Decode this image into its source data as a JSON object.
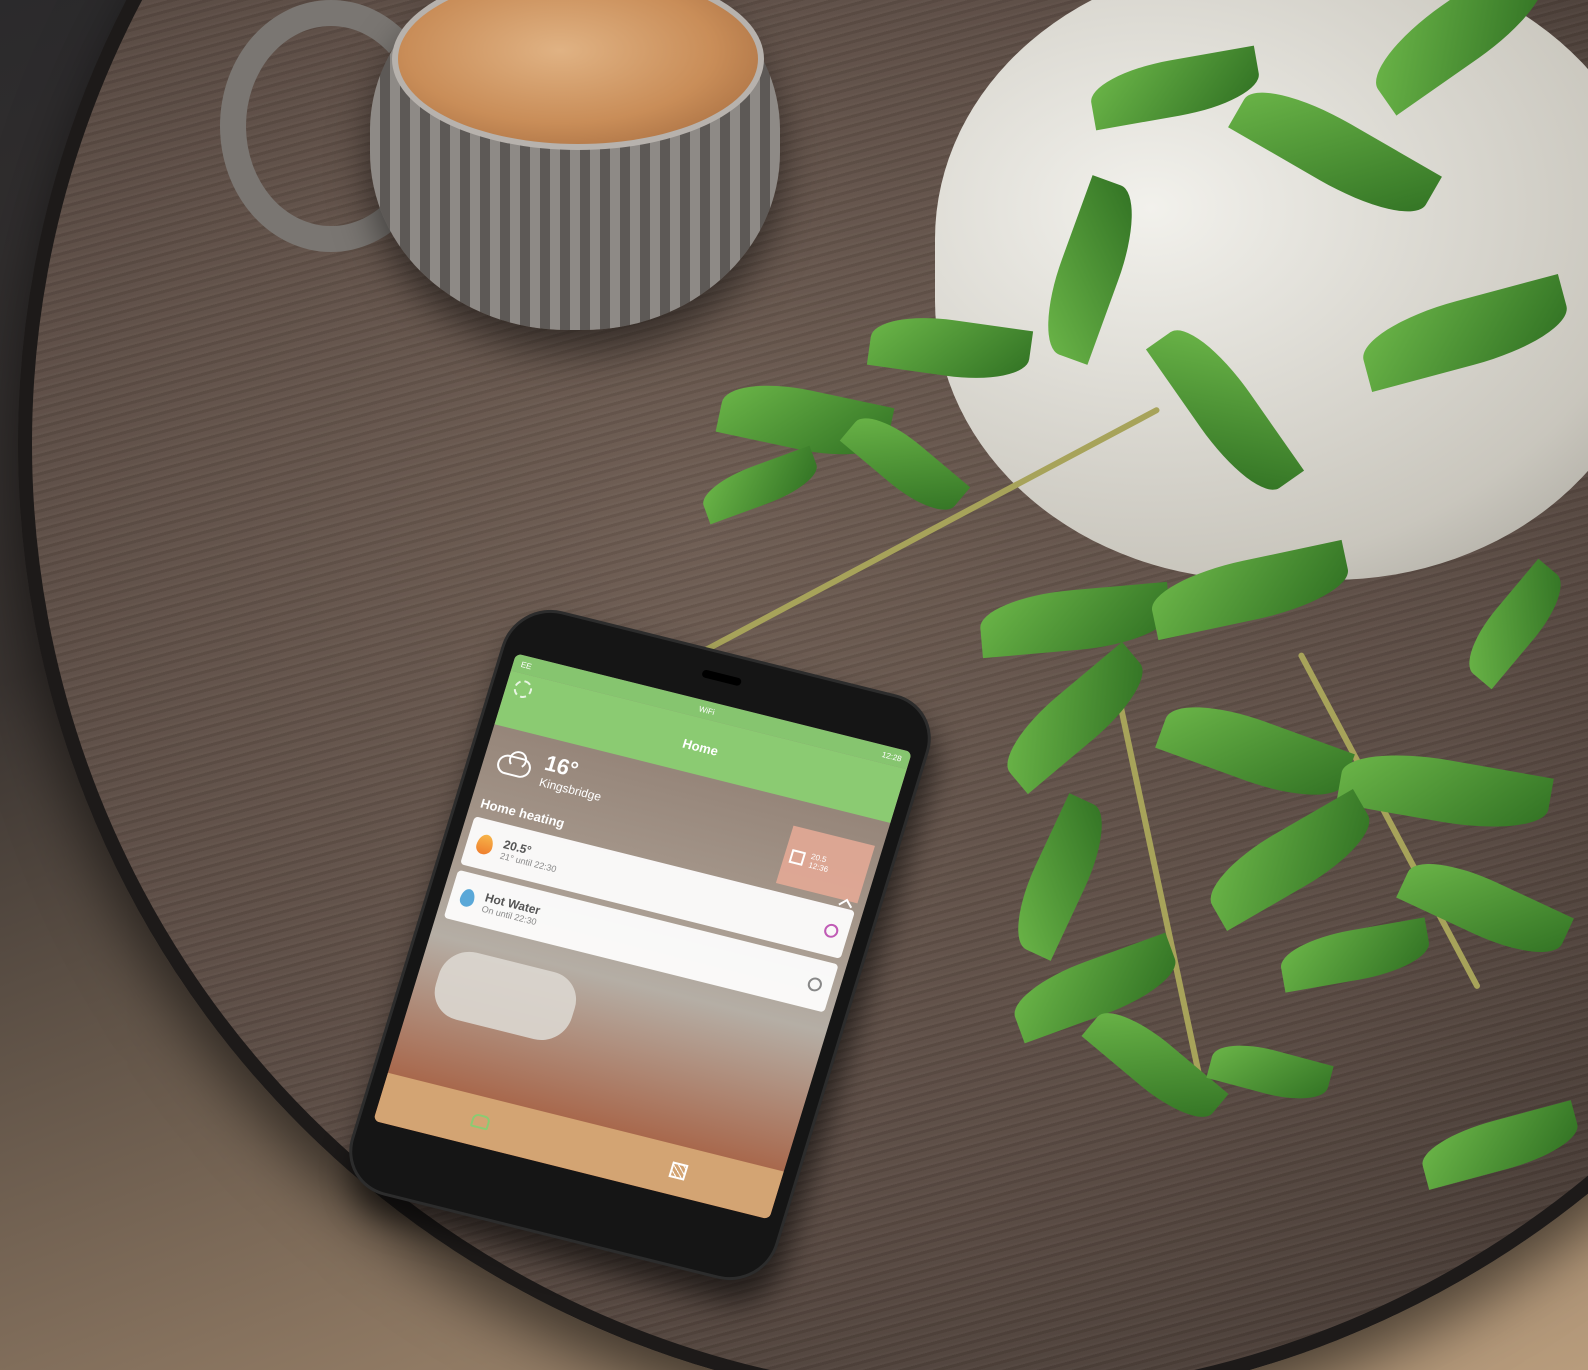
{
  "phone": {
    "status": {
      "carrier": "EE",
      "time": "12:28",
      "wifi": "WiFi"
    },
    "header": {
      "title": "Home"
    },
    "weather": {
      "temperature": "16°",
      "location": "Kingsbridge"
    },
    "section_label": "Home heating",
    "side_tile": {
      "line1": "20.5",
      "line2": "12:36"
    },
    "cards": [
      {
        "title": "20.5°",
        "subtitle": "21° until 22:30"
      },
      {
        "title": "Hot Water",
        "subtitle": "On until 22:30"
      }
    ]
  },
  "colors": {
    "accent_green": "#8bcb72",
    "heating_orange": "#ef7f2e",
    "water_blue": "#5aa8d8",
    "timer_purple": "#c05bb5",
    "tab_bar": "#d3a473"
  }
}
